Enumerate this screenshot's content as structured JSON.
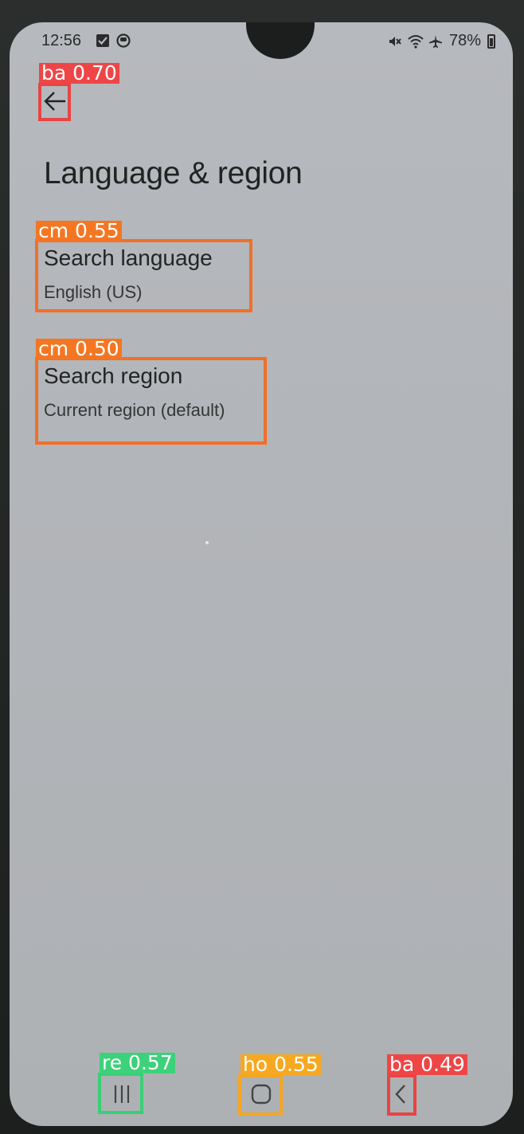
{
  "status_bar": {
    "time": "12:56",
    "battery": "78%",
    "icons": [
      "checkbox-notification-icon",
      "clock-notification-icon",
      "mute-icon",
      "wifi-icon",
      "airplane-icon",
      "battery-icon"
    ]
  },
  "header": {
    "back_icon": "arrow-left-icon",
    "title": "Language & region"
  },
  "settings": {
    "items": [
      {
        "title": "Search language",
        "subtitle": "English (US)"
      },
      {
        "title": "Search region",
        "subtitle": "Current region (default)"
      }
    ]
  },
  "navigation_bar": {
    "recents_icon": "recents-icon",
    "home_icon": "home-icon",
    "back_icon": "chevron-left-icon"
  },
  "detections": [
    {
      "label": "ba 0.70",
      "color": "#ee4646"
    },
    {
      "label": "cm 0.55",
      "color": "#f57622"
    },
    {
      "label": "cm 0.50",
      "color": "#f57622"
    },
    {
      "label": "re 0.57",
      "color": "#3dd17a"
    },
    {
      "label": "ho 0.55",
      "color": "#f6a821"
    },
    {
      "label": "ba 0.49",
      "color": "#ee4646"
    }
  ]
}
